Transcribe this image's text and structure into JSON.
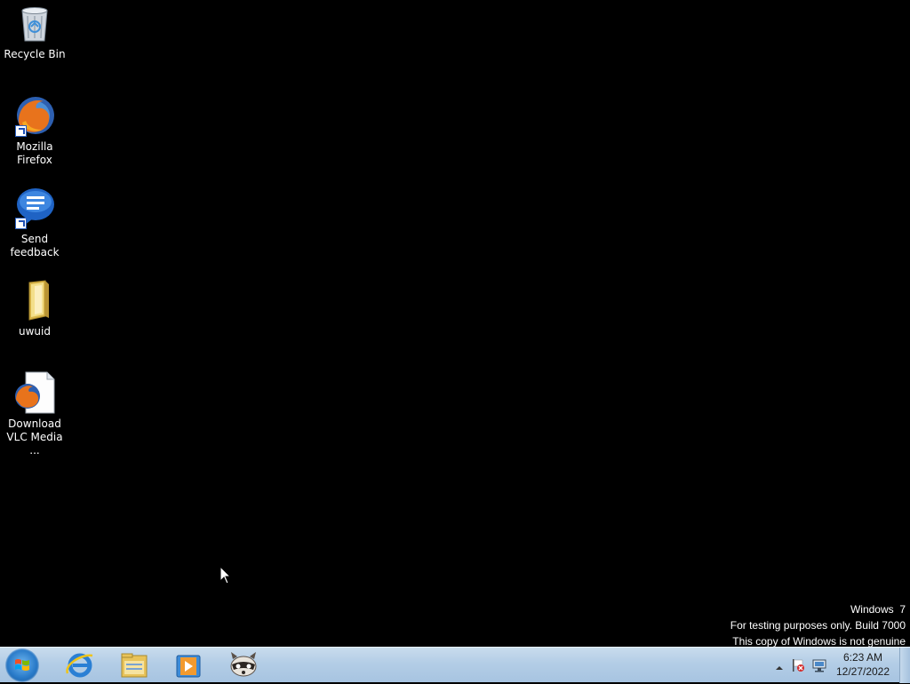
{
  "desktop": {
    "icons": [
      {
        "label": "Recycle Bin",
        "icon": "recycle-bin-icon"
      },
      {
        "label": "Mozilla Firefox",
        "icon": "firefox-icon"
      },
      {
        "label": "Send feedback",
        "icon": "feedback-icon"
      },
      {
        "label": "uwuid",
        "icon": "folder-icon"
      },
      {
        "label": "Download VLC Media ...",
        "icon": "firefox-document-icon"
      }
    ],
    "watermark": {
      "line1": "Windows  7",
      "line2": "For testing purposes only. Build 7000",
      "line3": "This copy of Windows is not genuine"
    }
  },
  "taskbar": {
    "start": {
      "icon": "windows-start-icon"
    },
    "pinned": [
      {
        "name": "Internet Explorer",
        "icon": "internet-explorer-icon"
      },
      {
        "name": "Windows Explorer",
        "icon": "file-explorer-icon"
      },
      {
        "name": "Windows Media Player",
        "icon": "media-player-icon"
      },
      {
        "name": "Raccoon app",
        "icon": "raccoon-icon"
      }
    ],
    "tray": {
      "time": "6:23 AM",
      "date": "12/27/2022",
      "icons": [
        "show-hidden-icons-icon",
        "action-center-flag-icon",
        "network-icon"
      ]
    }
  },
  "colors": {
    "desktop_background": "#000000",
    "taskbar_top": "#c9dced",
    "taskbar_bottom": "#a7c4e1"
  }
}
